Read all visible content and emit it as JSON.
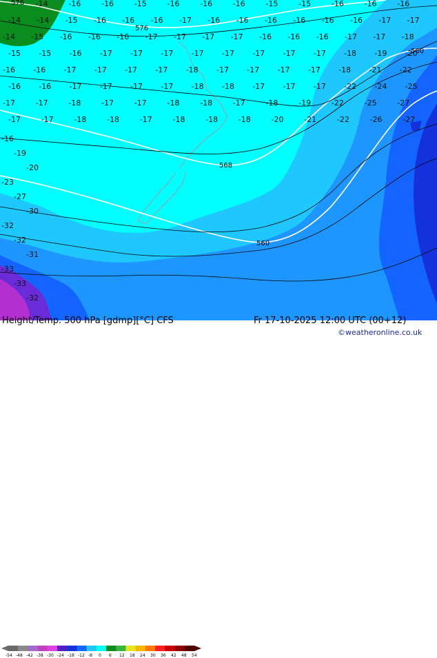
{
  "map": {
    "contours": [
      {
        "label": "576",
        "color": "#ffffff"
      },
      {
        "label": "576",
        "color": "#ffffff"
      },
      {
        "label": "568",
        "color": "#ffffff"
      },
      {
        "label": "560",
        "color": "#ffffff"
      },
      {
        "label": "560",
        "color": "#ffffff"
      }
    ],
    "isotherm_color": "#000000",
    "colors": {
      "cyan": "#00ffff",
      "light_blue": "#1ec8ff",
      "mid_blue": "#1e96ff",
      "blue": "#1464ff",
      "deep_blue": "#1432dc",
      "green": "#0a8c1e",
      "purple": "#6a2bd9",
      "magenta": "#b22fd0",
      "land_outline": "#9aa0a0"
    },
    "temps": [
      [
        "576",
        "-14",
        "-16",
        "-16",
        "-15",
        "-16",
        "-16",
        "-16",
        "-15",
        "-15",
        "-16",
        "-16",
        "-16"
      ],
      [
        "-14",
        "-14",
        "-15",
        "-16",
        "-16",
        "-16",
        "-17",
        "-16",
        "-16",
        "-16",
        "-16",
        "-16",
        "-16",
        "-17",
        "-17"
      ],
      [
        "-14",
        "-15",
        "-16",
        "-16",
        "-16",
        "-17",
        "-17",
        "-17",
        "-17",
        "-16",
        "-16",
        "-16",
        "-17",
        "-17",
        "-18"
      ],
      [
        "-15",
        "-15",
        "-16",
        "-17",
        "-17",
        "-17",
        "-17",
        "-17",
        "-17",
        "-17",
        "-17",
        "-18",
        "-19",
        "-20"
      ],
      [
        "-16",
        "-16",
        "-17",
        "-17",
        "-17",
        "-17",
        "-18",
        "-17",
        "-17",
        "-17",
        "-17",
        "-18",
        "-21",
        "-22"
      ],
      [
        "-16",
        "-16",
        "-17",
        "-17",
        "-17",
        "-17",
        "-18",
        "-18",
        "-17",
        "-17",
        "-17",
        "-22",
        "-24",
        "-25"
      ],
      [
        "-17",
        "-17",
        "-18",
        "-17",
        "-17",
        "-18",
        "-18",
        "-17",
        "-18",
        "-19",
        "-22",
        "-25",
        "-27"
      ],
      [
        "-17",
        "-17",
        "-18",
        "-18",
        "-17",
        "-18",
        "-18",
        "-18",
        "-20",
        "-21",
        "-22",
        "-26",
        "-27"
      ]
    ],
    "row_labels_left": [
      "-16",
      "-19",
      "-20",
      "-23",
      "-27",
      "-30",
      "-32",
      "-32",
      "-31",
      "-33",
      "-33",
      "-32"
    ]
  },
  "title": "Height/Temp. 500 hPa [gdmp][°C] CFS",
  "datetime": "Fr 17-10-2025 12:00 UTC (00+12)",
  "copyright": "©weatheronline.co.uk",
  "colorbar": {
    "ticks": [
      "-54",
      "-48",
      "-42",
      "-38",
      "-30",
      "-24",
      "-18",
      "-12",
      "-8",
      "0",
      "6",
      "12",
      "18",
      "24",
      "30",
      "36",
      "42",
      "48",
      "54"
    ],
    "colors": [
      "#6b6b6b",
      "#8a8a8a",
      "#a46ad0",
      "#c040c0",
      "#e040e0",
      "#5020c0",
      "#1432dc",
      "#1464ff",
      "#1ec8ff",
      "#00ffff",
      "#0a8c1e",
      "#3cb43c",
      "#e6e61e",
      "#ffb400",
      "#ff7800",
      "#ff1e1e",
      "#c80000",
      "#8c0000",
      "#500000"
    ]
  }
}
